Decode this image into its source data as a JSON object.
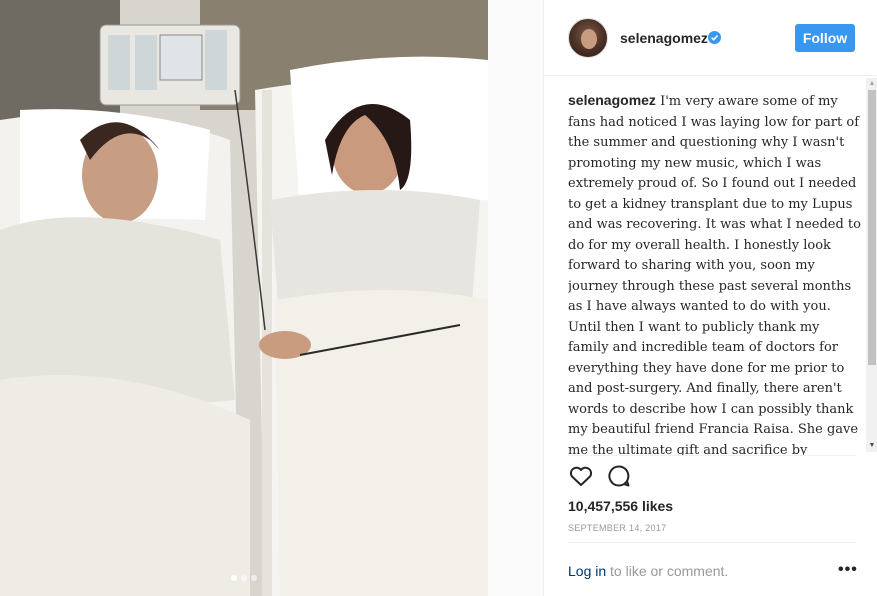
{
  "post": {
    "username": "selenagomez",
    "follow_label": "Follow",
    "caption_text": "I'm very aware some of my fans had noticed I was laying low for part of the summer and questioning why I wasn't promoting my new music, which I was extremely proud of. So I found out I needed to get a kidney transplant due to my Lupus and was recovering. It was what I needed to do for my overall health. I honestly look forward to sharing with you, soon my journey through these past several months as I have always wanted to do with you. Until then I want to publicly thank my family and incredible team of doctors for everything they have done for me prior to and post-surgery. And finally, there aren't words to describe how I can possibly thank my beautiful friend Francia Raisa. She gave me the ultimate gift and sacrifice by donating her kidney to me. I am incredibly blessed. I love you so much sis.",
    "likes_label": "10,457,556 likes",
    "date_label": "SEPTEMBER 14, 2017",
    "login_link": "Log in",
    "login_rest": " to like or comment.",
    "more_label": "•••",
    "carousel": {
      "total": 3,
      "active_index": 0
    }
  },
  "icons": {
    "verified": "verified-badge-icon",
    "like": "heart-icon",
    "comment": "comment-icon",
    "more": "more-options-icon"
  },
  "colors": {
    "accent": "#3897f0",
    "link": "#003569",
    "muted": "#999999",
    "text": "#262626"
  }
}
